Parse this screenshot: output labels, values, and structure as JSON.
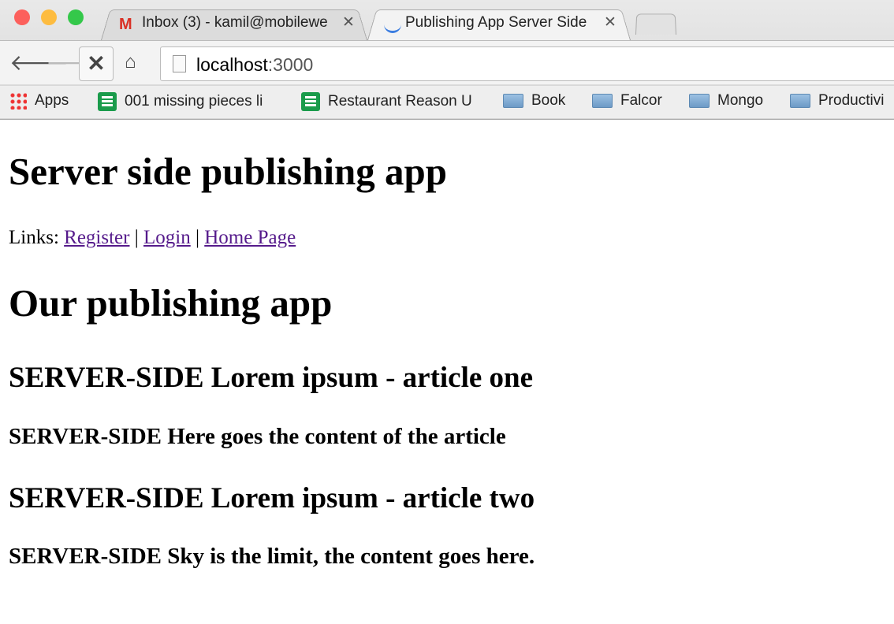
{
  "browser": {
    "tabs": [
      {
        "title": "Inbox (3) - kamil@mobilewe",
        "icon": "gmail-icon",
        "active": false
      },
      {
        "title": "Publishing App Server Side",
        "icon": "loading-spinner-icon",
        "active": true
      }
    ],
    "url_host": "localhost",
    "url_port": ":3000",
    "bookmarks": [
      {
        "label": "Apps",
        "icon": "apps-grid-icon"
      },
      {
        "label": "001 missing pieces li",
        "icon": "sheets-icon"
      },
      {
        "label": "Restaurant Reason U",
        "icon": "sheets-icon"
      },
      {
        "label": "Book",
        "icon": "folder-icon"
      },
      {
        "label": "Falcor",
        "icon": "folder-icon"
      },
      {
        "label": "Mongo",
        "icon": "folder-icon"
      },
      {
        "label": "Productivi",
        "icon": "folder-icon"
      }
    ]
  },
  "page": {
    "title": "Server side publishing app",
    "links_label": "Links:",
    "links": [
      "Register",
      "Login",
      "Home Page"
    ],
    "separator": "|",
    "heading": "Our publishing app",
    "articles": [
      {
        "title": "SERVER-SIDE Lorem ipsum - article one",
        "content": "SERVER-SIDE Here goes the content of the article"
      },
      {
        "title": "SERVER-SIDE Lorem ipsum - article two",
        "content": "SERVER-SIDE Sky is the limit, the content goes here."
      }
    ],
    "link_color": "#551a8b"
  }
}
